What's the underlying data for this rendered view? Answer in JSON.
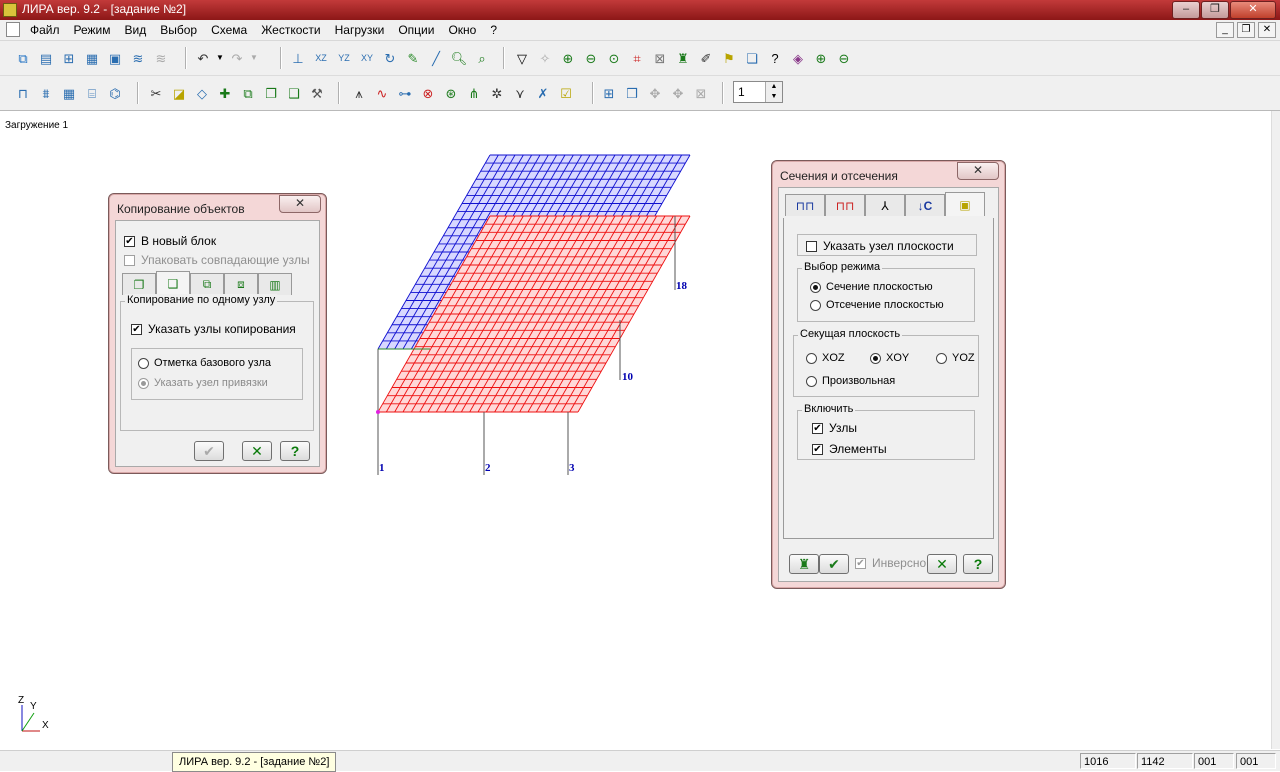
{
  "window": {
    "title": "ЛИРА  вер. 9.2 - [задание №2]"
  },
  "menu": {
    "items": [
      "Файл",
      "Режим",
      "Вид",
      "Выбор",
      "Схема",
      "Жесткости",
      "Нагрузки",
      "Опции",
      "Окно",
      "?"
    ]
  },
  "toolbar2": {
    "spinner_value": "1"
  },
  "canvas": {
    "load_case_label": "Загружение  1",
    "node_labels": [
      "1",
      "2",
      "3",
      "10",
      "18"
    ],
    "axes": {
      "x": "X",
      "y": "Y",
      "z": "Z"
    }
  },
  "copy_dialog": {
    "title": "Копирование объектов",
    "close_label": "✕",
    "new_block": {
      "label": "В новый блок",
      "checked": true
    },
    "pack_nodes": {
      "label": "Упаковать совпадающие узлы",
      "checked": false,
      "disabled": true
    },
    "group_title": "Копирование по одному узлу",
    "specify_nodes": {
      "label": "Указать узлы копирования",
      "checked": true
    },
    "radio_base": "Отметка базового узла",
    "radio_anchor": "Указать узел привязки"
  },
  "sections_dialog": {
    "title": "Сечения и отсечения",
    "close_label": "✕",
    "plane_node": {
      "label": "Указать узел плоскости",
      "checked": false
    },
    "mode_group": "Выбор режима",
    "mode_section": "Сечение плоскостью",
    "mode_cut": "Отсечение плоскостью",
    "plane_group": "Секущая плоскость",
    "plane_xoz": "XOZ",
    "plane_xoy": "XOY",
    "plane_yoz": "YOZ",
    "plane_arbitrary": "Произвольная",
    "include_group": "Включить",
    "include_nodes": {
      "label": "Узлы",
      "checked": true
    },
    "include_elements": {
      "label": "Элементы",
      "checked": true
    },
    "inverse": {
      "label": "Инверсно",
      "checked": true,
      "disabled": true
    }
  },
  "statusbar": {
    "task_label": "ЛИРА  вер. 9.2 - [задание №2]",
    "cells": [
      "1016",
      "1142",
      "001",
      "001"
    ]
  },
  "colors": {
    "titlebar": "#9e1f1f",
    "dialog_frame": "#f4d7d7",
    "blue_block": "#1010d0",
    "red_block": "#ee1010"
  }
}
